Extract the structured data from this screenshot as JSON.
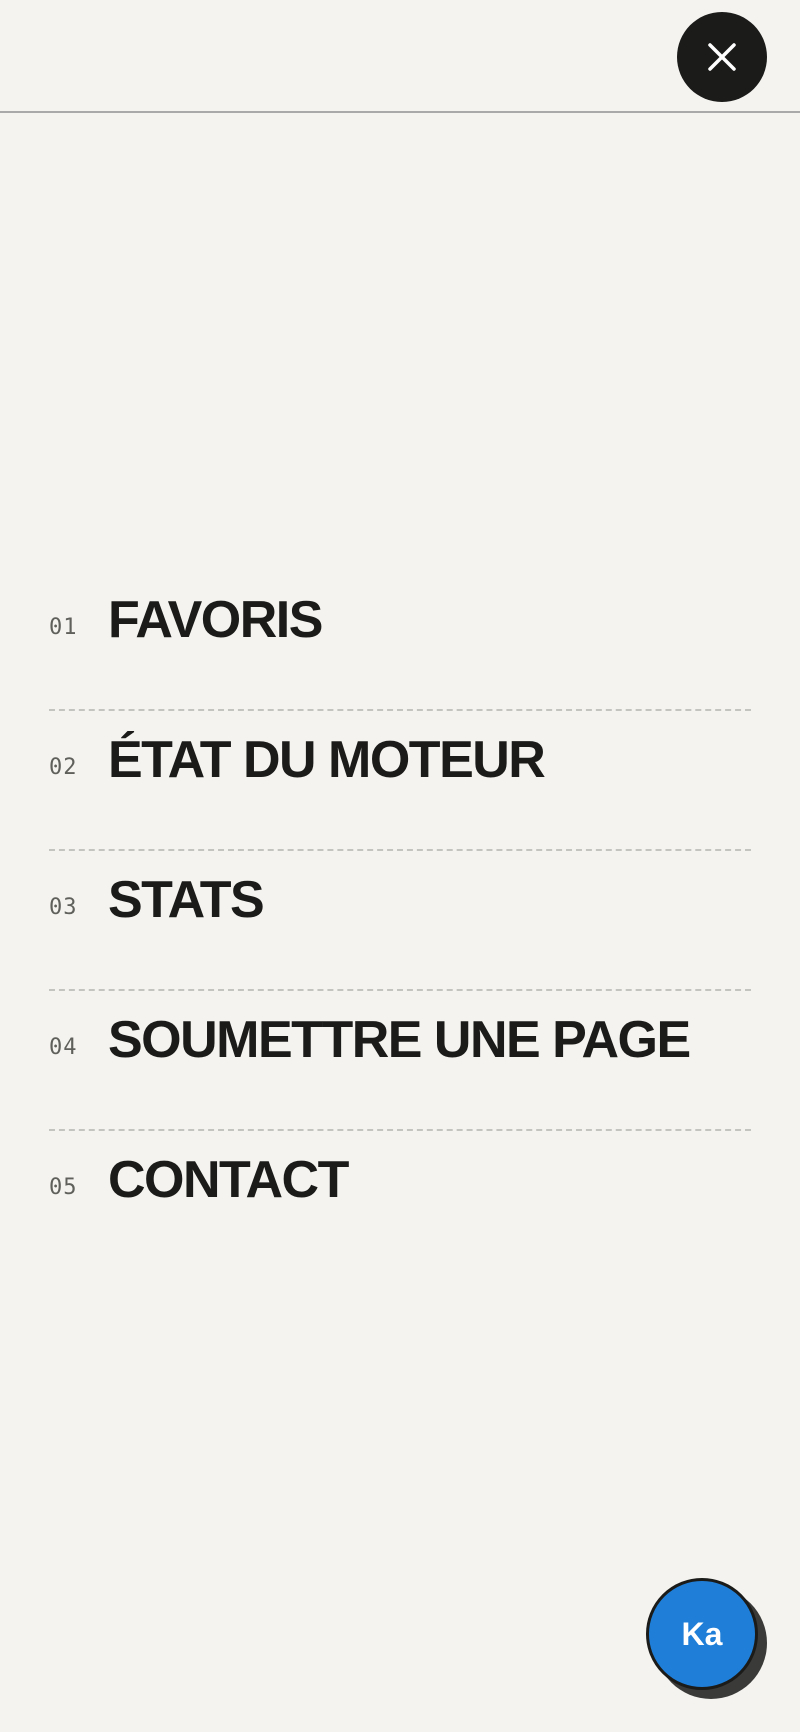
{
  "header": {
    "close_icon": "close-icon"
  },
  "menu": {
    "items": [
      {
        "number": "01",
        "label": "FAVORIS"
      },
      {
        "number": "02",
        "label": "ÉTAT DU MOTEUR"
      },
      {
        "number": "03",
        "label": "STATS"
      },
      {
        "number": "04",
        "label": "SOUMETTRE UNE PAGE"
      },
      {
        "number": "05",
        "label": "CONTACT"
      }
    ]
  },
  "avatar": {
    "initials": "Ka",
    "color": "#1f7fd8"
  },
  "colors": {
    "background": "#f4f3f0",
    "text": "#1b1b19",
    "number": "#5f5f5b",
    "divider": "#c3c3c0"
  }
}
